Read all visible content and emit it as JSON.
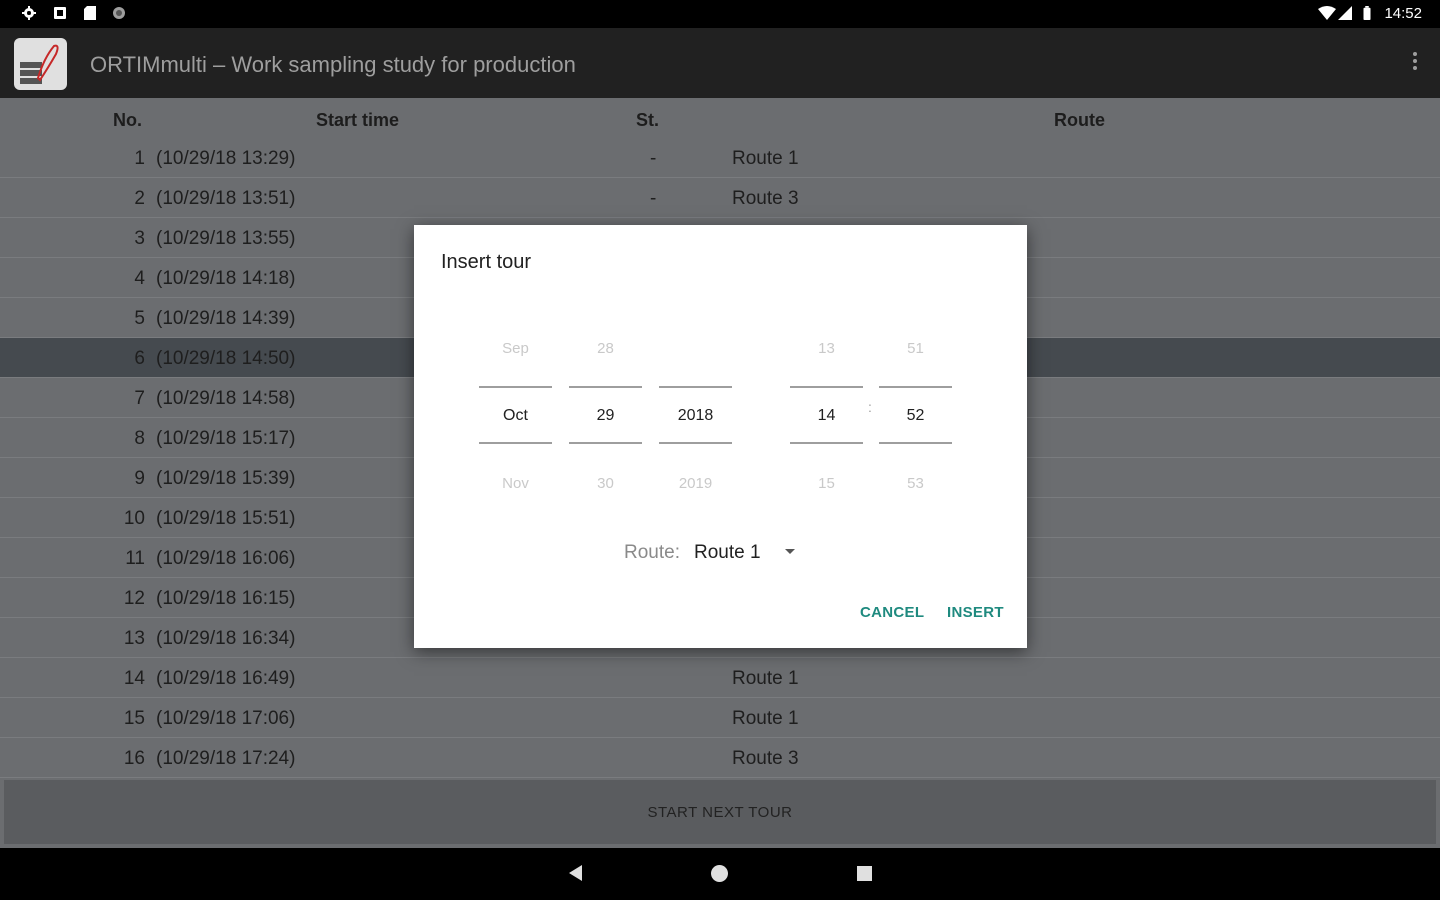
{
  "status_bar": {
    "time": "14:52",
    "left_icons": [
      "gear-icon",
      "download-icon",
      "sd-card-icon",
      "circle-icon"
    ],
    "right_icons": [
      "wifi-icon",
      "signal-icon",
      "battery-icon"
    ]
  },
  "app_bar": {
    "title": "ORTIMmulti – Work sampling study for production",
    "menu_icon": "overflow-menu-icon"
  },
  "table": {
    "columns": {
      "no": "No.",
      "start_time": "Start time",
      "status": "St.",
      "route": "Route"
    },
    "rows": [
      {
        "no": "1",
        "time": "(10/29/18 13:29)",
        "st": "-",
        "route": "Route 1"
      },
      {
        "no": "2",
        "time": "(10/29/18 13:51)",
        "st": "-",
        "route": "Route 3"
      },
      {
        "no": "3",
        "time": "(10/29/18 13:55)",
        "st": "",
        "route": ""
      },
      {
        "no": "4",
        "time": "(10/29/18 14:18)",
        "st": "",
        "route": ""
      },
      {
        "no": "5",
        "time": "(10/29/18 14:39)",
        "st": "",
        "route": ""
      },
      {
        "no": "6",
        "time": "(10/29/18 14:50)",
        "st": "",
        "route": ""
      },
      {
        "no": "7",
        "time": "(10/29/18 14:58)",
        "st": "",
        "route": ""
      },
      {
        "no": "8",
        "time": "(10/29/18 15:17)",
        "st": "",
        "route": ""
      },
      {
        "no": "9",
        "time": "(10/29/18 15:39)",
        "st": "",
        "route": ""
      },
      {
        "no": "10",
        "time": "(10/29/18 15:51)",
        "st": "",
        "route": ""
      },
      {
        "no": "11",
        "time": "(10/29/18 16:06)",
        "st": "",
        "route": ""
      },
      {
        "no": "12",
        "time": "(10/29/18 16:15)",
        "st": "",
        "route": ""
      },
      {
        "no": "13",
        "time": "(10/29/18 16:34)",
        "st": "",
        "route": ""
      },
      {
        "no": "14",
        "time": "(10/29/18 16:49)",
        "st": "",
        "route": "Route 1"
      },
      {
        "no": "15",
        "time": "(10/29/18 17:06)",
        "st": "",
        "route": "Route 1"
      },
      {
        "no": "16",
        "time": "(10/29/18 17:24)",
        "st": "",
        "route": "Route 3"
      }
    ],
    "selected_row": 6
  },
  "start_next_tour": "START NEXT TOUR",
  "dialog": {
    "title": "Insert tour",
    "month": {
      "prev": "Sep",
      "current": "Oct",
      "next": "Nov"
    },
    "day": {
      "prev": "28",
      "current": "29",
      "next": "30"
    },
    "year": {
      "prev": "",
      "current": "2018",
      "next": "2019"
    },
    "hour": {
      "prev": "13",
      "current": "14",
      "next": "15"
    },
    "minute": {
      "prev": "51",
      "current": "52",
      "next": "53"
    },
    "time_separator": ":",
    "route_label": "Route:",
    "route_value": "Route 1",
    "cancel": "CANCEL",
    "insert": "INSERT"
  },
  "colors": {
    "accent": "#1f8a7f",
    "app_bar": "#212121",
    "list_bg": "#6b6d70",
    "selected_row": "#454a4f"
  }
}
